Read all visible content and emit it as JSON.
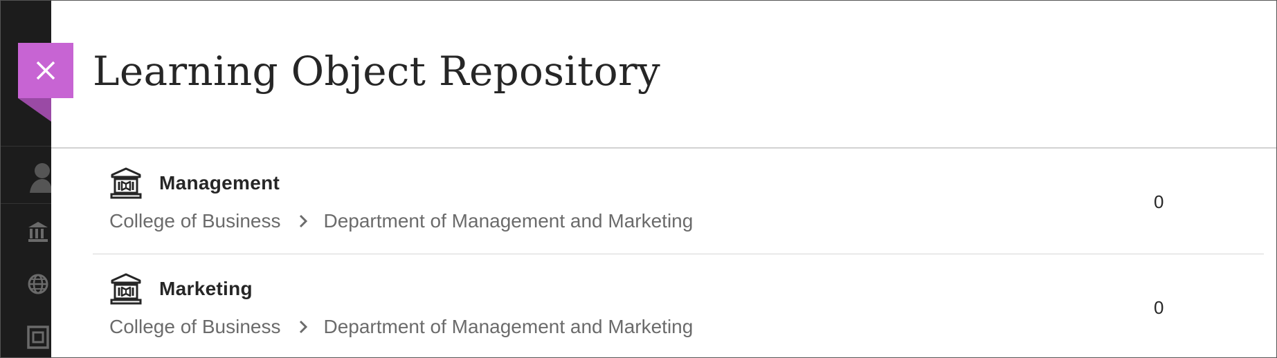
{
  "panel": {
    "title": "Learning Object Repository"
  },
  "close": {
    "label": "Close",
    "icon": "close-icon",
    "color": "#c764d3"
  },
  "rail": {
    "icons": [
      "avatar-icon",
      "institution-icon",
      "globe-icon",
      "calendar-icon"
    ]
  },
  "repositories": [
    {
      "title": "Management",
      "icon": "institution-icon",
      "breadcrumb": [
        "College of Business",
        "Department of Management and Marketing"
      ],
      "count": "0"
    },
    {
      "title": "Marketing",
      "icon": "institution-icon",
      "breadcrumb": [
        "College of Business",
        "Department of Management and Marketing"
      ],
      "count": "0"
    }
  ]
}
